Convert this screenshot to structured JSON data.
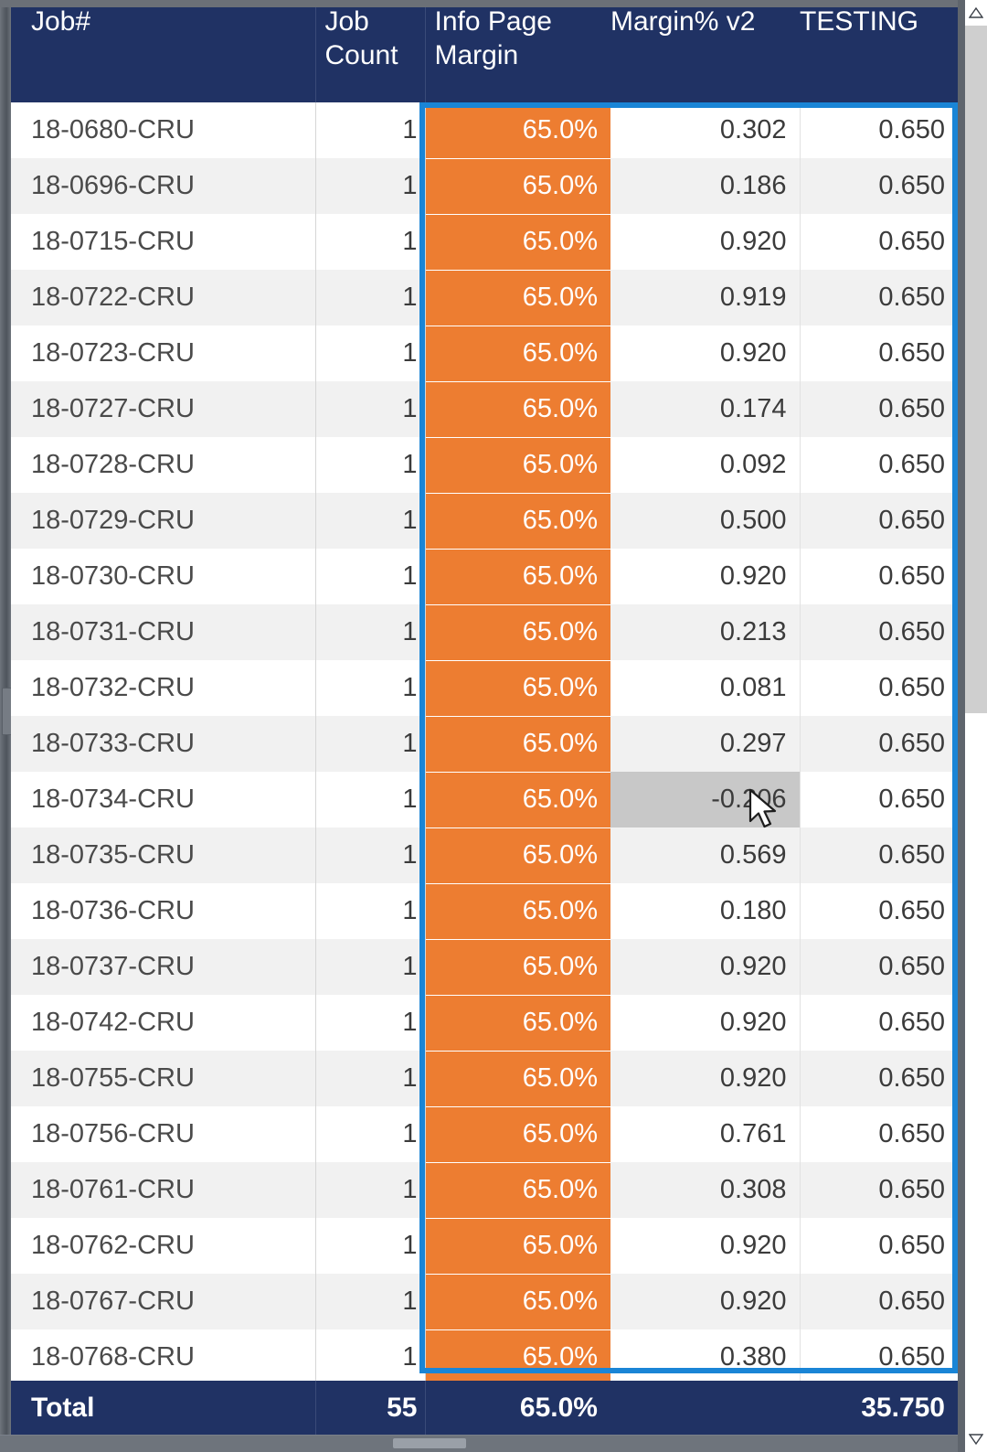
{
  "table": {
    "columns": [
      {
        "key": "job",
        "label": "Job#"
      },
      {
        "key": "count",
        "label": "Job\nCount"
      },
      {
        "key": "info",
        "label": "Info Page\nMargin"
      },
      {
        "key": "margin",
        "label": "Margin% v2"
      },
      {
        "key": "testing",
        "label": "TESTING"
      }
    ],
    "header_labels": {
      "job": "Job#",
      "count_line1": "Job",
      "count_line2": "Count",
      "info_line1": "Info Page",
      "info_line2": "Margin",
      "margin": "Margin% v2",
      "testing": "TESTING"
    },
    "rows": [
      {
        "job": "18-0680-CRU",
        "count": "1",
        "info": "65.0%",
        "margin": "0.302",
        "testing": "0.650"
      },
      {
        "job": "18-0696-CRU",
        "count": "1",
        "info": "65.0%",
        "margin": "0.186",
        "testing": "0.650"
      },
      {
        "job": "18-0715-CRU",
        "count": "1",
        "info": "65.0%",
        "margin": "0.920",
        "testing": "0.650"
      },
      {
        "job": "18-0722-CRU",
        "count": "1",
        "info": "65.0%",
        "margin": "0.919",
        "testing": "0.650"
      },
      {
        "job": "18-0723-CRU",
        "count": "1",
        "info": "65.0%",
        "margin": "0.920",
        "testing": "0.650"
      },
      {
        "job": "18-0727-CRU",
        "count": "1",
        "info": "65.0%",
        "margin": "0.174",
        "testing": "0.650"
      },
      {
        "job": "18-0728-CRU",
        "count": "1",
        "info": "65.0%",
        "margin": "0.092",
        "testing": "0.650"
      },
      {
        "job": "18-0729-CRU",
        "count": "1",
        "info": "65.0%",
        "margin": "0.500",
        "testing": "0.650"
      },
      {
        "job": "18-0730-CRU",
        "count": "1",
        "info": "65.0%",
        "margin": "0.920",
        "testing": "0.650"
      },
      {
        "job": "18-0731-CRU",
        "count": "1",
        "info": "65.0%",
        "margin": "0.213",
        "testing": "0.650"
      },
      {
        "job": "18-0732-CRU",
        "count": "1",
        "info": "65.0%",
        "margin": "0.081",
        "testing": "0.650"
      },
      {
        "job": "18-0733-CRU",
        "count": "1",
        "info": "65.0%",
        "margin": "0.297",
        "testing": "0.650"
      },
      {
        "job": "18-0734-CRU",
        "count": "1",
        "info": "65.0%",
        "margin": "-0.206",
        "testing": "0.650",
        "hovered": true
      },
      {
        "job": "18-0735-CRU",
        "count": "1",
        "info": "65.0%",
        "margin": "0.569",
        "testing": "0.650"
      },
      {
        "job": "18-0736-CRU",
        "count": "1",
        "info": "65.0%",
        "margin": "0.180",
        "testing": "0.650"
      },
      {
        "job": "18-0737-CRU",
        "count": "1",
        "info": "65.0%",
        "margin": "0.920",
        "testing": "0.650"
      },
      {
        "job": "18-0742-CRU",
        "count": "1",
        "info": "65.0%",
        "margin": "0.920",
        "testing": "0.650"
      },
      {
        "job": "18-0755-CRU",
        "count": "1",
        "info": "65.0%",
        "margin": "0.920",
        "testing": "0.650"
      },
      {
        "job": "18-0756-CRU",
        "count": "1",
        "info": "65.0%",
        "margin": "0.761",
        "testing": "0.650"
      },
      {
        "job": "18-0761-CRU",
        "count": "1",
        "info": "65.0%",
        "margin": "0.308",
        "testing": "0.650"
      },
      {
        "job": "18-0762-CRU",
        "count": "1",
        "info": "65.0%",
        "margin": "0.920",
        "testing": "0.650"
      },
      {
        "job": "18-0767-CRU",
        "count": "1",
        "info": "65.0%",
        "margin": "0.920",
        "testing": "0.650"
      },
      {
        "job": "18-0768-CRU",
        "count": "1",
        "info": "65.0%",
        "margin": "0.380",
        "testing": "0.650"
      }
    ],
    "total": {
      "job": "Total",
      "count": "55",
      "info": "65.0%",
      "margin": "",
      "testing": "35.750"
    }
  },
  "colors": {
    "header_navy": "#203264",
    "conditional_orange": "#ED7D31",
    "selection_blue": "#1a85d6",
    "row_alt": "#f1f1f1",
    "hover_gray": "#c8c8c8"
  }
}
